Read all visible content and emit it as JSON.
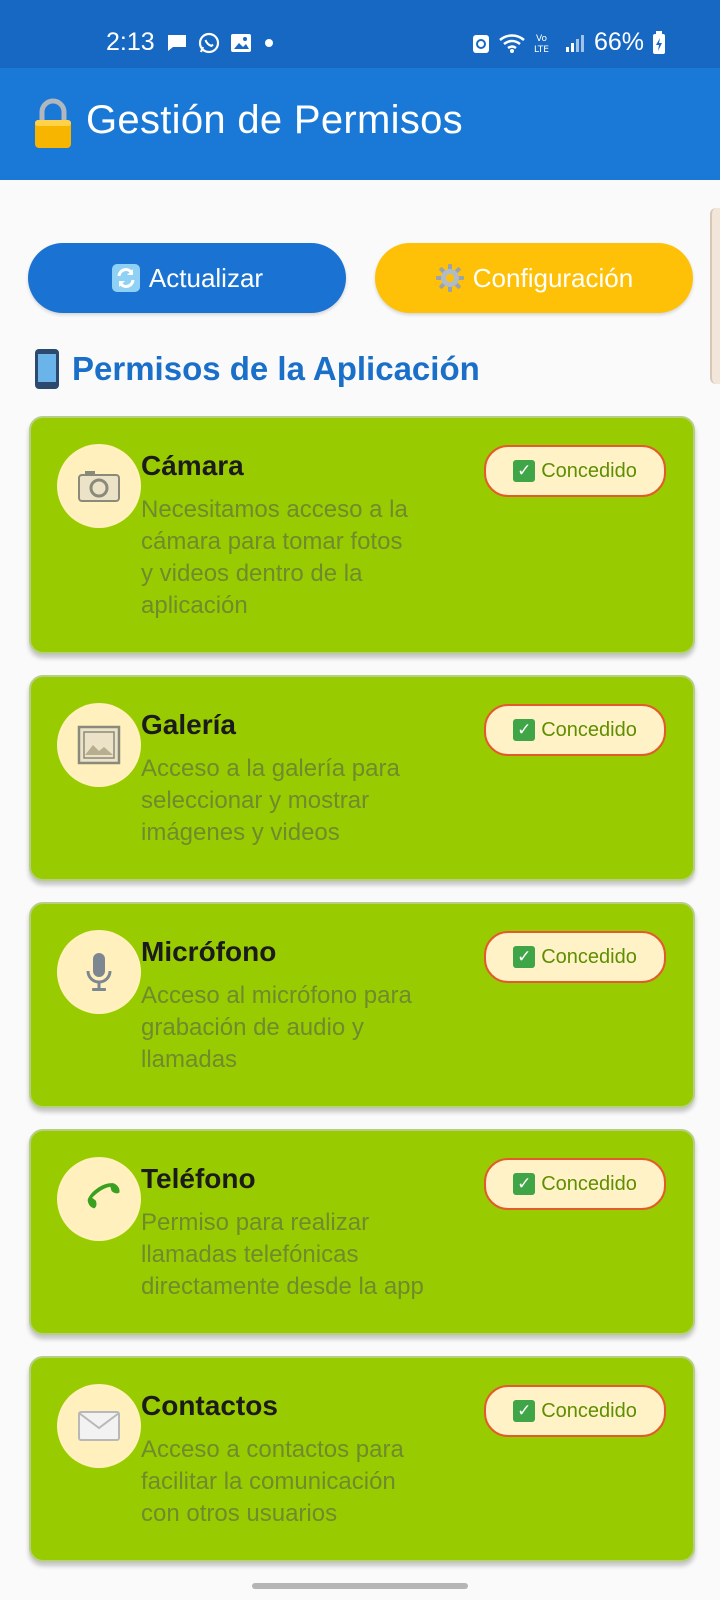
{
  "status_bar": {
    "time": "2:13",
    "battery": "66%",
    "left_icons": [
      "message-icon",
      "whatsapp-icon",
      "gallery-notification-icon",
      "dot-icon"
    ],
    "right_icons": [
      "recycle-icon",
      "wifi-icon",
      "volte-icon",
      "signal-icon",
      "battery-icon"
    ]
  },
  "app_bar": {
    "title": "Gestión de Permisos",
    "icon": "lock-icon"
  },
  "actions": {
    "refresh_label": "Actualizar",
    "config_label": "Configuración"
  },
  "section": {
    "title": "Permisos de la Aplicación",
    "icon": "phone-icon"
  },
  "permissions": [
    {
      "title": "Cámara",
      "description_lines": [
        "Necesitamos acceso a la",
        "cámara para tomar fotos",
        "y videos dentro de la",
        "aplicación"
      ],
      "status": "Concedido",
      "icon": "camera-icon"
    },
    {
      "title": "Galería",
      "description_lines": [
        "Acceso a la galería para",
        "seleccionar y mostrar",
        "imágenes y videos"
      ],
      "status": "Concedido",
      "icon": "image-icon"
    },
    {
      "title": "Micrófono",
      "description_lines": [
        "Acceso al micrófono para",
        "grabación de audio y",
        "llamadas"
      ],
      "status": "Concedido",
      "icon": "microphone-icon"
    },
    {
      "title": "Teléfono",
      "description_lines": [
        "Permiso para realizar",
        "llamadas telefónicas",
        "directamente desde la app"
      ],
      "status": "Concedido",
      "icon": "phone-handset-icon"
    },
    {
      "title": "Contactos",
      "description_lines": [
        "Acceso a contactos para",
        "facilitar la comunicación",
        "con otros usuarios"
      ],
      "status": "Concedido",
      "icon": "envelope-icon"
    }
  ],
  "colors": {
    "status_bar": "#1668c2",
    "app_bar": "#1a78d6",
    "refresh_button": "#1a72d2",
    "config_button": "#ffc107",
    "card": "#99cc00",
    "badge_bg": "#fff2c6",
    "badge_border": "#e35a2b",
    "section_title": "#1a6fc9"
  }
}
